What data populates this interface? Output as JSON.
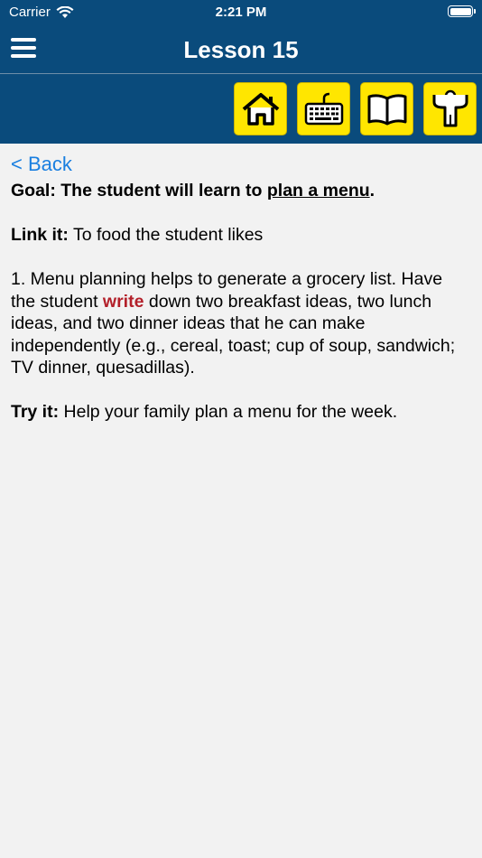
{
  "status": {
    "carrier": "Carrier",
    "time": "2:21 PM"
  },
  "nav": {
    "title": "Lesson 15"
  },
  "toolbar": {
    "icons": [
      "home-icon",
      "keyboard-icon",
      "book-icon",
      "person-icon"
    ]
  },
  "content": {
    "back": "< Back",
    "goal_label": "Goal:",
    "goal_text": "The student will learn to",
    "goal_link": "plan a menu",
    "goal_end": ".",
    "link_label": "Link it:",
    "link_text": "To food the student likes",
    "step1_a": "1. Menu planning helps to generate a grocery list. Have the student",
    "step1_highlight": "write",
    "step1_b": "down two breakfast ideas, two lunch ideas, and two dinner ideas that he can make independently (e.g., cereal, toast; cup of soup, sandwich; TV dinner, quesadillas).",
    "try_label": "Try it:",
    "try_text": "Help your family plan a menu for the week."
  },
  "colors": {
    "bar": "#0a4b7c",
    "tool": "#ffe600",
    "link": "#1a7fe0",
    "highlight": "#b3202a"
  }
}
